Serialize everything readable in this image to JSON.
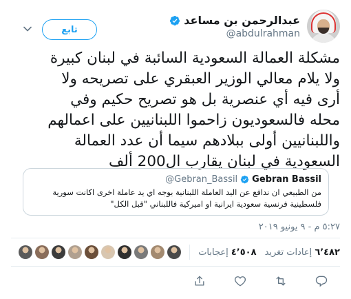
{
  "author": {
    "name": "عبدالرحمن بن مساعد",
    "handle": "@abdulrahman"
  },
  "follow_label": "تابع",
  "tweet_text": "مشكلة العمالة السعودية السائبة في لبنان كبيرة\nولا يلام معالي الوزير العبقري على تصريحه ولا\nأرى فيه أي عنصرية بل هو تصريح حكيم وفي\nمحله فالسعوديون زاحموا اللبنانيين على اعمالهم\nواللبنانيين أولى ببلادهم سيما أن عدد العمالة\nالسعودية في لبنان يقارب ال200 ألف",
  "quote": {
    "name": "Gebran Bassil",
    "handle": "@Gebran_Bassil",
    "text": "من الطبيعي ان ندافع عن اليد العاملة اللبنانية بوجه اي يد عاملة اخرى اكانت سورية فلسطينية فرنسية سعودية ايرانية او اميركية فاللبناني \"قبل الكل\""
  },
  "timestamp": "٥:٢٧ م - ٩ يونيو ٢٠١٩",
  "stats": {
    "retweets_count": "٦٬٤٨٢",
    "retweets_label": "إعادات تغريد",
    "likes_count": "٤٬٥٠٨",
    "likes_label": "إعجابات"
  },
  "likers": [
    "avatar-1",
    "avatar-2",
    "avatar-3",
    "avatar-4",
    "avatar-5",
    "avatar-6",
    "avatar-7",
    "avatar-8",
    "avatar-9",
    "avatar-10"
  ],
  "colors": {
    "accent": "#1da1f2",
    "text": "#14171a",
    "secondary": "#657786",
    "border": "#e6ecf0"
  },
  "icons": [
    "caret-down-icon",
    "verified-badge-icon",
    "reply-icon",
    "retweet-icon",
    "like-icon",
    "share-icon"
  ]
}
